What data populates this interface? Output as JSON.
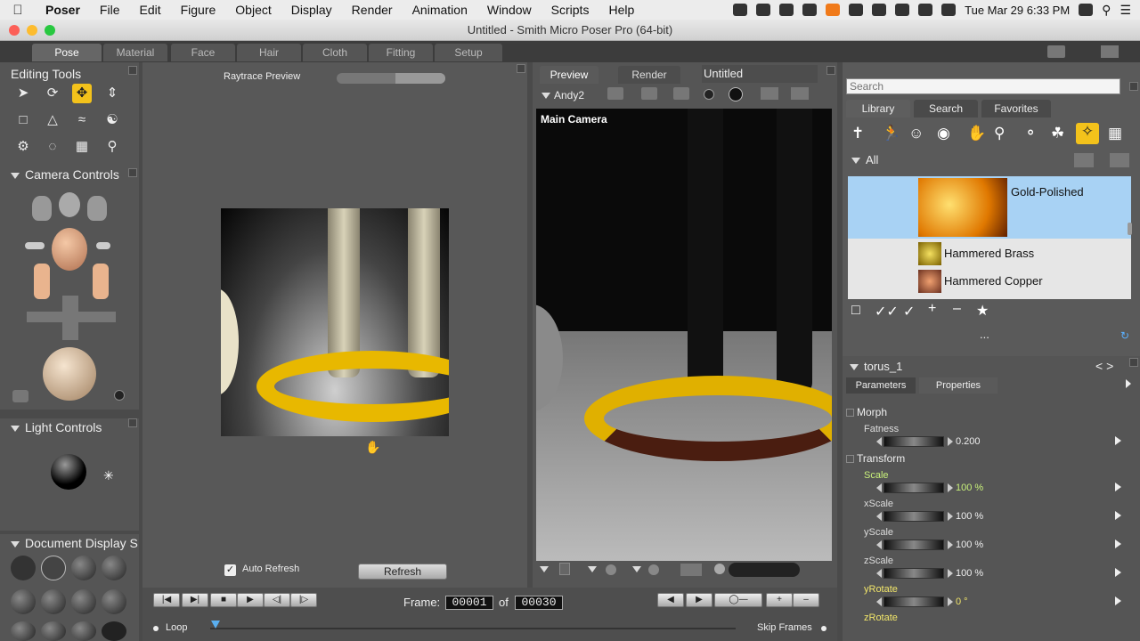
{
  "menubar": {
    "app": "Poser",
    "items": [
      "File",
      "Edit",
      "Figure",
      "Object",
      "Display",
      "Render",
      "Animation",
      "Window",
      "Scripts",
      "Help"
    ],
    "clock": "Tue Mar 29  6:33 PM"
  },
  "window": {
    "title": "Untitled - Smith Micro Poser Pro  (64-bit)"
  },
  "room_tabs": [
    "Pose",
    "Material",
    "Face",
    "Hair",
    "Cloth",
    "Fitting",
    "Setup"
  ],
  "left": {
    "editing_tools": "Editing Tools",
    "camera_controls": "Camera Controls",
    "light_controls": "Light Controls",
    "document_display": "Document Display S"
  },
  "raytrace": {
    "title": "Raytrace Preview",
    "auto_refresh": "Auto Refresh",
    "refresh_button": "Refresh"
  },
  "viewport": {
    "tabs": [
      "Preview",
      "Render"
    ],
    "doc_title": "Untitled",
    "figure": "Andy2",
    "camera_label": "Main Camera"
  },
  "library": {
    "search_placeholder": "Search",
    "tabs": [
      "Library",
      "Search",
      "Favorites"
    ],
    "folder": "All",
    "items": [
      "Gold-Polished",
      "Hammered Brass",
      "Hammered Copper"
    ],
    "more": "..."
  },
  "params": {
    "object": "torus_1",
    "nav": "< >",
    "tabs": [
      "Parameters",
      "Properties"
    ],
    "groups": {
      "morph": "Morph",
      "transform": "Transform"
    },
    "rows": [
      {
        "label": "Fatness",
        "value": "0.200"
      },
      {
        "label": "Scale",
        "value": "100 %"
      },
      {
        "label": "xScale",
        "value": "100 %"
      },
      {
        "label": "yScale",
        "value": "100 %"
      },
      {
        "label": "zScale",
        "value": "100 %"
      },
      {
        "label": "yRotate",
        "value": "0 °"
      },
      {
        "label": "zRotate",
        "value": ""
      }
    ]
  },
  "animation": {
    "frame_label": "Frame:",
    "frame": "00001",
    "of": "of",
    "total": "00030",
    "loop": "Loop",
    "skip_frames": "Skip Frames"
  }
}
